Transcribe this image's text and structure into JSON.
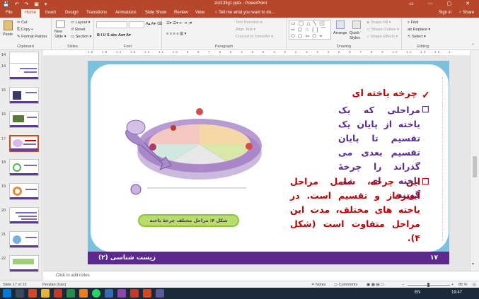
{
  "window": {
    "title": "zist13fig1.pptx - PowerPoint",
    "quick_access": "💾 ↶ ↷ ▣ ▾",
    "controls": "▭ — ▢ ✕"
  },
  "tabs": [
    "File",
    "Home",
    "Insert",
    "Design",
    "Transitions",
    "Animations",
    "Slide Show",
    "Review",
    "View"
  ],
  "tell_me": "♀ Tell me what you want to do...",
  "account": {
    "sign_in": "Sign in",
    "share": "♂ Share"
  },
  "ribbon": {
    "clipboard": {
      "label": "Clipboard",
      "paste": "Paste",
      "cut": "✂ Cut",
      "copy": "⎘ Copy ▾",
      "format_painter": "✎ Format Painter"
    },
    "slides": {
      "label": "Slides",
      "new_slide": "New Slide ▾",
      "layout": "▭ Layout ▾",
      "reset": "↺ Reset",
      "section": "▭ Section ▾"
    },
    "font": {
      "label": "Font",
      "format_row": "B I U S abc  Aa▾  A▾",
      "size_row": "A▴ A▾ ⌫"
    },
    "paragraph": {
      "label": "Paragraph",
      "text_direction": "Text Direction ▾",
      "align_text": "Align Text ▾",
      "smartart": "Convert to SmartArt ▾",
      "list_row": "☰▾ ☰▾ ⇤ ⇥ ↕▾",
      "align_row": "≡ ≡ ≡ ≡ ▥ ▾"
    },
    "drawing": {
      "label": "Drawing",
      "shapes": "▭ ◯ △ ╲ ⬜ ⇨ ⬠ ☆ { } ⌒ ⬭ ▢ ⇦ ⬡ ⌖ ☁ ✚",
      "arrange": "Arrange",
      "quick_styles": "Quick Styles",
      "shape_fill": "◈ Shape Fill ▾",
      "shape_outline": "▭ Shape Outline ▾",
      "shape_effects": "◇ Shape Effects ▾"
    },
    "editing": {
      "label": "Editing",
      "find": "⌕ Find",
      "replace": "ab Replace ▾",
      "select": "↖ Select ▾"
    }
  },
  "thumbnails": [
    {
      "num": "14"
    },
    {
      "num": "15"
    },
    {
      "num": "16"
    },
    {
      "num": "17"
    },
    {
      "num": "18"
    },
    {
      "num": "19"
    },
    {
      "num": "20"
    },
    {
      "num": "21"
    },
    {
      "num": "22"
    }
  ],
  "ruler": "16 · 15 · 14 · 13 · 12 · 11 · 10 · 9 · 8 · 7 · 6 · 5 · 4 · 3 · 2 · 1 · 0 · 1 · 2 · 3 · 4 · 5 · 6 · 7 · 8 · 9 · 10 · 11 · 12 · 13 · 14 · 15 · 16",
  "slide": {
    "heading": "چرخه یاخته ای",
    "heading_mark": "✓",
    "para1": "مراحلی که یک یاخته از پایان یک تقسیم تا پایان تقسیم بعدی می گذراند را چرخهٔ یاخته ای می گویند.",
    "para1_mark": "☐",
    "para2": "این چرخه، شامل مراحل اینترفاز و تقسیم است. در یاخته های مختلف، مدت این مراحل متفاوت است (شکل ۴).",
    "para2_mark": "☐",
    "caption": "شکل ۴: مراحل مختلف چرخهٔ یاخته",
    "footer_title": "زیست شناسی (۲)",
    "page_number": "۱۷",
    "colors": {
      "heading": "#c00000",
      "para1": "#5b2c8f",
      "para2": "#c00000",
      "footer": "#5c2a8c",
      "frame": "#7bc0dc"
    }
  },
  "notes_placeholder": "Click to add notes",
  "status": {
    "slide": "Slide 17 of 22",
    "language": "Persian (Iran)",
    "notes": "≐ Notes",
    "comments": "▭ Comments",
    "view_buttons": "▣ ▦ ▤ ▭",
    "zoom": "85 %",
    "zoom_minus": "−",
    "zoom_plus": "+",
    "fit": "⊡"
  },
  "taskbar": {
    "language": "EN",
    "clock": "19:47"
  }
}
